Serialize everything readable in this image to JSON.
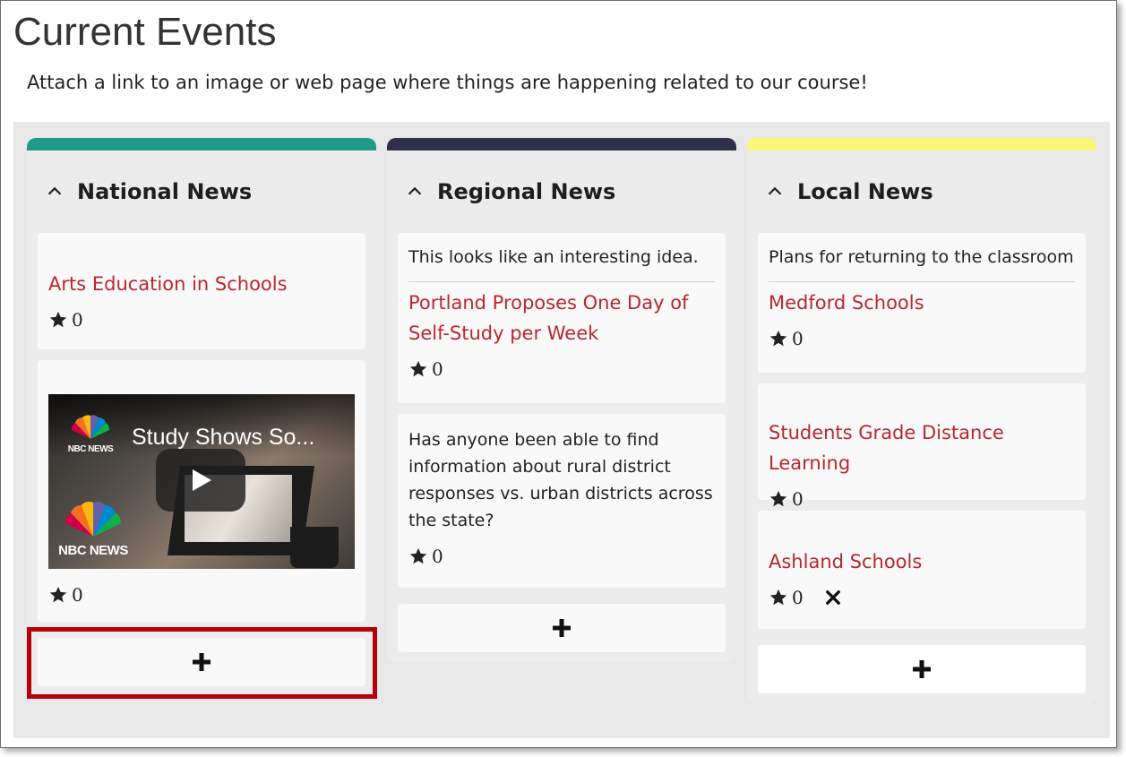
{
  "page": {
    "title": "Current Events",
    "description": "Attach a link to an image or web page where things are happening related to our course!"
  },
  "colors": {
    "national_bar": "#1f9a86",
    "regional_bar": "#2f2f4a",
    "local_bar": "#fbf77a",
    "link": "#b8282e",
    "highlight": "#b5000c"
  },
  "columns": [
    {
      "title": "National News",
      "cards": [
        {
          "text": "",
          "link": "Arts Education in Schools",
          "stars": "0"
        },
        {
          "text": "",
          "video_title": "Study Shows So...",
          "logo_text": "NBC NEWS",
          "stars": "0"
        }
      ]
    },
    {
      "title": "Regional News",
      "cards": [
        {
          "text": "This looks like an interesting idea.",
          "link": "Portland Proposes One Day of Self-Study per Week",
          "stars": "0"
        },
        {
          "text": "Has anyone been able to find information about rural district responses vs. urban districts across the state?",
          "link": "",
          "stars": "0"
        }
      ]
    },
    {
      "title": "Local News",
      "cards": [
        {
          "text": "Plans for returning to the classroom",
          "link": "Medford Schools",
          "stars": "0"
        },
        {
          "text": "",
          "link": "Students Grade Distance Learning",
          "stars": "0"
        },
        {
          "text": "",
          "link": "Ashland Schools",
          "stars": "0"
        }
      ]
    }
  ],
  "icons": {
    "collapse": "chevron-up-icon",
    "star": "star-icon",
    "add": "plus-icon",
    "delete": "close-icon",
    "play": "play-icon"
  }
}
